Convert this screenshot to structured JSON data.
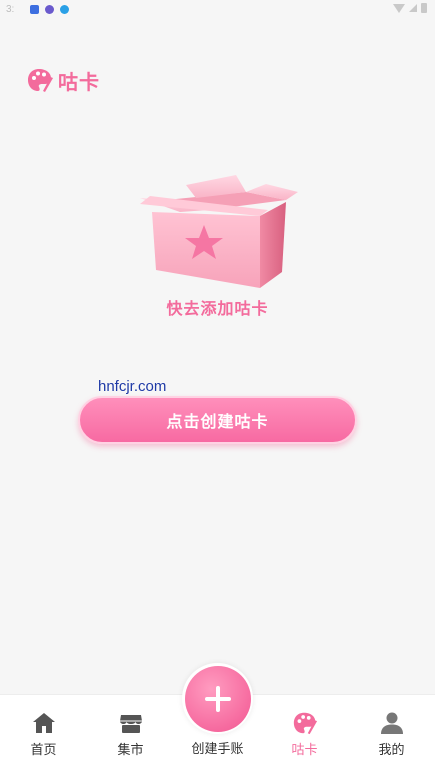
{
  "status_bar": {
    "time": "3:",
    "icons": [
      "app-icon",
      "moon-icon",
      "download-icon"
    ],
    "right_icons": [
      "wifi-icon",
      "signal-icon",
      "battery-icon"
    ]
  },
  "header": {
    "title": "咕卡",
    "logo_icon": "palette-icon",
    "color": "#f36b9c"
  },
  "empty_state": {
    "illustration": "gift-box-icon",
    "text": "快去添加咕卡"
  },
  "watermark": "hnfcjr.com",
  "create_button": {
    "label": "点击创建咕卡"
  },
  "bottom_nav": {
    "items": [
      {
        "label": "首页",
        "icon": "home-icon",
        "active": false
      },
      {
        "label": "集市",
        "icon": "shop-icon",
        "active": false
      },
      {
        "label": "创建手账",
        "icon": "plus-icon",
        "active": false
      },
      {
        "label": "咕卡",
        "icon": "palette-icon",
        "active": true
      },
      {
        "label": "我的",
        "icon": "user-icon",
        "active": false
      }
    ],
    "active_color": "#f36b9c"
  }
}
